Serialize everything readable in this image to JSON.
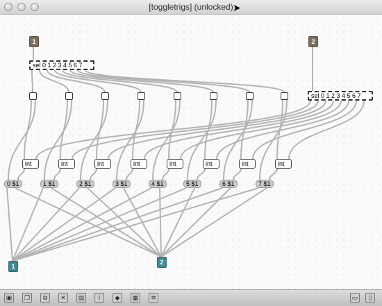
{
  "window": {
    "title": "[toggletrigs] (unlocked)"
  },
  "patch": {
    "inlets": [
      "1",
      "2"
    ],
    "outlets": [
      "1",
      "2"
    ],
    "sel_top": "sel 0 1 2 3 4 5 6 7",
    "sel_right": "sel 0 1 2 3 4 5 6 7",
    "ints": [
      "int",
      "int",
      "int",
      "int",
      "int",
      "int",
      "int",
      "int"
    ],
    "messages": [
      "0 $1",
      "1 $1",
      "2 $1",
      "3 $1",
      "4 $1",
      "5 $1",
      "6 $1",
      "7 $1"
    ]
  },
  "toolbar": {
    "buttons": [
      "lock-icon",
      "copy-icon",
      "subpatch-icon",
      "delete-icon",
      "present-icon",
      "info-icon",
      "inspector-icon",
      "grid-icon",
      "settings-icon"
    ],
    "right_buttons": [
      "split-view-icon",
      "sidebar-icon"
    ]
  }
}
